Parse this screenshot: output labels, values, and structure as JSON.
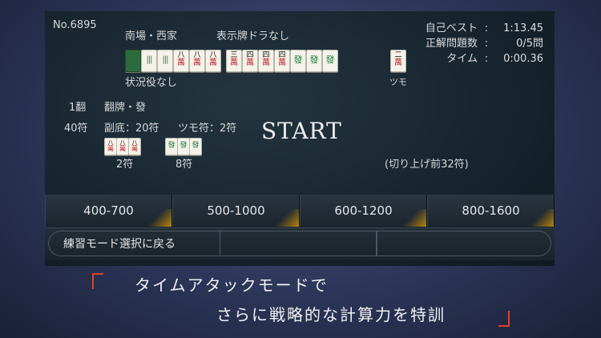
{
  "problem": {
    "number": "No.6895"
  },
  "round": {
    "wind": "南場・西家",
    "dora": "表示牌ドラなし",
    "situation": "状況役なし",
    "win_type": "ツモ"
  },
  "stats": [
    {
      "label": "自己ベスト",
      "value": "1:13.45"
    },
    {
      "label": "正解問題数",
      "value": "0/5問"
    },
    {
      "label": "タイム",
      "value": "0:00.36"
    }
  ],
  "hand": {
    "concealed_tiles": [
      {
        "kind": "back",
        "name": "tile-back"
      },
      {
        "kind": "bamboo",
        "top": "",
        "bot": "|||",
        "name": "sou-tile"
      },
      {
        "kind": "bamboo",
        "top": "",
        "bot": "|||",
        "name": "sou-tile"
      },
      {
        "kind": "man",
        "top": "八",
        "bot": "萬",
        "name": "man-tile"
      },
      {
        "kind": "man",
        "top": "八",
        "bot": "萬",
        "name": "man-tile"
      },
      {
        "kind": "man",
        "top": "八",
        "bot": "萬",
        "name": "man-tile"
      }
    ],
    "open_tiles": [
      {
        "kind": "man",
        "top": "三",
        "bot": "萬",
        "name": "man-tile"
      },
      {
        "kind": "man",
        "top": "四",
        "bot": "萬",
        "name": "man-tile"
      },
      {
        "kind": "man",
        "top": "四",
        "bot": "萬",
        "name": "man-tile"
      },
      {
        "kind": "man",
        "top": "四",
        "bot": "萬",
        "name": "man-tile"
      },
      {
        "kind": "green",
        "top": "",
        "bot": "發",
        "name": "hatsu-tile"
      },
      {
        "kind": "green",
        "top": "",
        "bot": "發",
        "name": "hatsu-tile"
      },
      {
        "kind": "green",
        "top": "",
        "bot": "發",
        "name": "hatsu-tile"
      }
    ],
    "win_tile": {
      "kind": "man",
      "top": "二",
      "bot": "萬",
      "name": "man-tile"
    }
  },
  "scoring": {
    "han": "1翻",
    "yaku": "翻牌・發",
    "fu": "40符",
    "base_fu": "副底：20符",
    "tsumo_fu": "ツモ符：2符",
    "meld1_fu": "2符",
    "meld2_fu": "8符",
    "rounding_note": "(切り上げ前32符)",
    "meld1_tiles": [
      {
        "kind": "man",
        "top": "八",
        "bot": "萬"
      },
      {
        "kind": "man",
        "top": "八",
        "bot": "萬"
      },
      {
        "kind": "man",
        "top": "八",
        "bot": "萬"
      }
    ],
    "meld2_tiles": [
      {
        "kind": "green",
        "top": "",
        "bot": "發"
      },
      {
        "kind": "green",
        "top": "",
        "bot": "發"
      },
      {
        "kind": "green",
        "top": "",
        "bot": "發"
      }
    ]
  },
  "start_label": "START",
  "choices": [
    "400-700",
    "500-1000",
    "600-1200",
    "800-1600"
  ],
  "back_button": "練習モード選択に戻る",
  "captions": {
    "line1": "タイムアタックモードで",
    "line2": "さらに戦略的な計算力を特訓"
  },
  "colors": {
    "accent_gold": "#b8860b",
    "bracket_red": "#d9452a",
    "man_red": "#c12020",
    "hatsu_green": "#1d7d3a"
  }
}
